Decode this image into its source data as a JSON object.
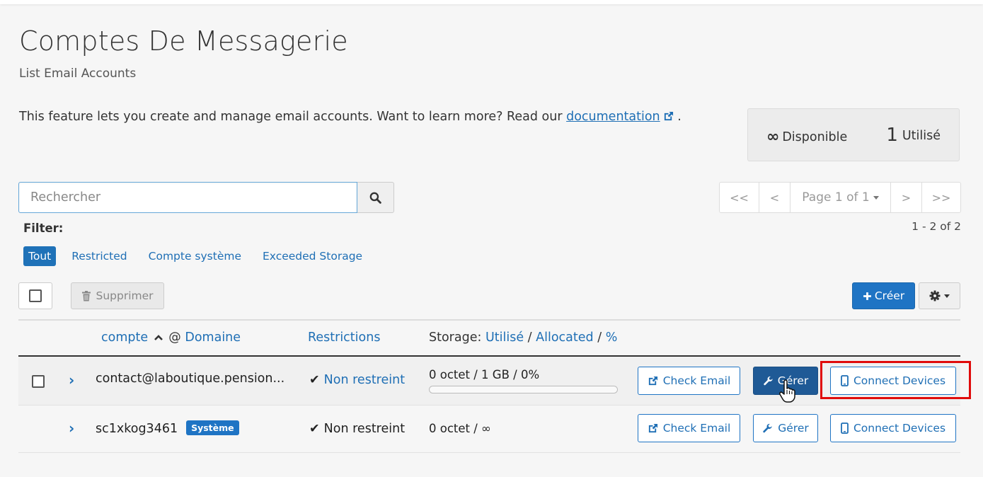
{
  "page": {
    "title": "Comptes De Messagerie",
    "subtitle": "List Email Accounts",
    "intro_text": "This feature lets you create and manage email accounts. Want to learn more? Read our",
    "intro_link": "documentation",
    "intro_end": "."
  },
  "stats": {
    "available_symbol": "∞",
    "available_label": "Disponible",
    "used_count": "1",
    "used_label": "Utilisé"
  },
  "search": {
    "placeholder": "Rechercher"
  },
  "pagination": {
    "first": "<<",
    "prev": "<",
    "page_label": "Page 1 of 1",
    "next": ">",
    "last": ">>",
    "range": "1 - 2 of 2"
  },
  "filter": {
    "label": "Filter:",
    "options": [
      "Tout",
      "Restricted",
      "Compte système",
      "Exceeded Storage"
    ],
    "active": "Tout"
  },
  "toolbar": {
    "delete_label": "Supprimer",
    "create_label": "Créer"
  },
  "table": {
    "headers": {
      "account_link": "compte",
      "at_sign": "@",
      "domain_link": "Domaine",
      "restrictions": "Restrictions",
      "storage_prefix": "Storage:",
      "storage_used": "Utilisé",
      "slash1": "/",
      "storage_allocated": "Allocated",
      "slash2": "/",
      "storage_percent": "%"
    },
    "rows": [
      {
        "account": "contact@laboutique.pension...",
        "restriction": "Non restreint",
        "storage": "0 octet / 1 GB / 0%",
        "storage_fraction": 0,
        "check_email": "Check Email",
        "manage": "Gérer",
        "connect": "Connect Devices"
      },
      {
        "account": "sc1xkog3461",
        "badge": "Système",
        "restriction": "Non restreint",
        "storage": "0 octet / ∞",
        "check_email": "Check Email",
        "manage": "Gérer",
        "connect": "Connect Devices"
      }
    ]
  },
  "colors": {
    "link_blue": "#1f6fb5",
    "primary_button": "#1f74c4",
    "highlight_red": "#e00b0b"
  }
}
